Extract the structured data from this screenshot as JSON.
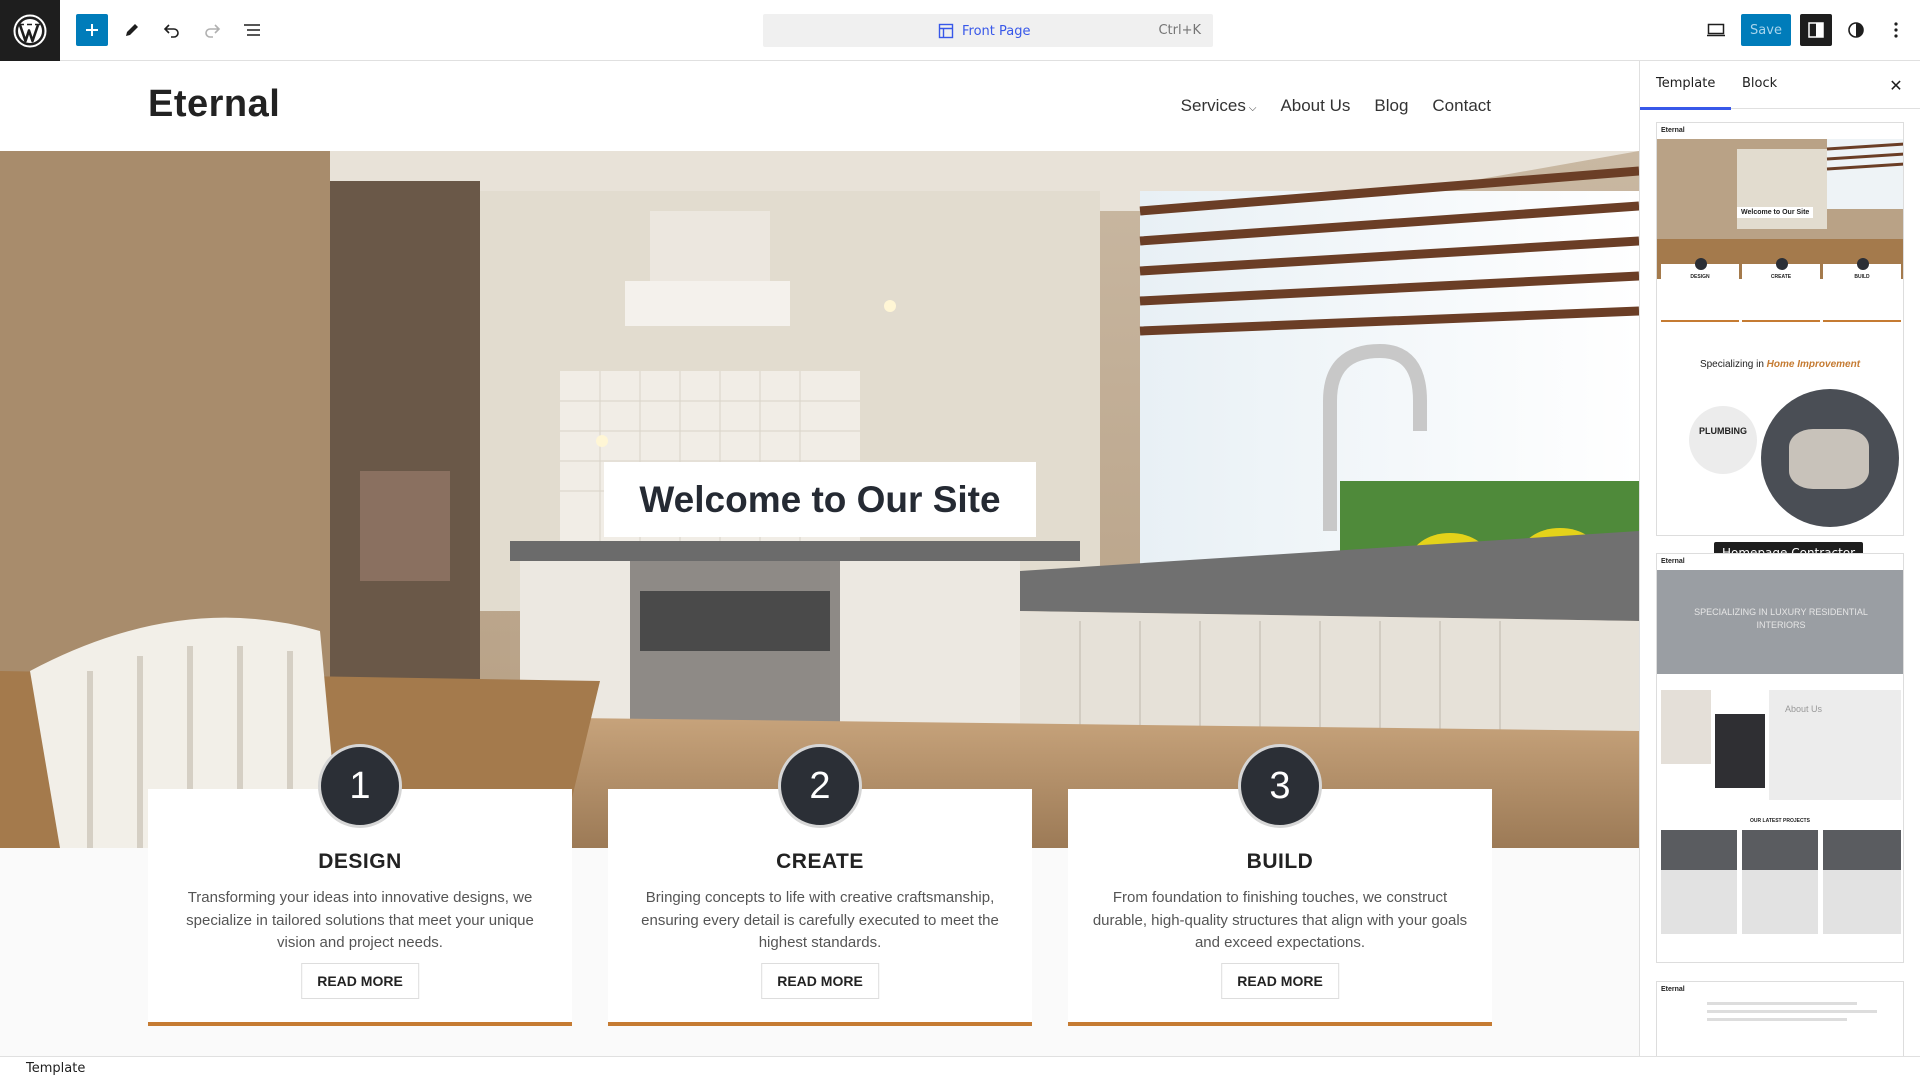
{
  "toolbar": {
    "logo_icon": "wordpress-icon",
    "add_icon": "plus-icon",
    "tools_icon": "pencil-icon",
    "undo_icon": "undo-icon",
    "redo_icon": "redo-icon",
    "list_view_icon": "list-view-icon",
    "command_bar": {
      "page_title": "Front Page",
      "shortcut": "Ctrl+K",
      "icon": "layout-icon"
    },
    "view_icon": "desktop-icon",
    "save_label": "Save",
    "settings_icon": "sidebar-icon",
    "styles_icon": "contrast-icon",
    "options_icon": "kebab-icon",
    "accent_color": "#007cba"
  },
  "site": {
    "title": "Eternal",
    "nav": [
      {
        "label": "Services",
        "has_submenu": true
      },
      {
        "label": "About Us"
      },
      {
        "label": "Blog"
      },
      {
        "label": "Contact"
      }
    ],
    "hero_title": "Welcome to Our Site",
    "cards": [
      {
        "number": "1",
        "title": "DESIGN",
        "text": "Transforming your ideas into innovative designs, we specialize in tailored solutions that meet your unique vision and project needs.",
        "button": "READ MORE"
      },
      {
        "number": "2",
        "title": "CREATE",
        "text": "Bringing concepts to life with creative craftsmanship, ensuring every detail is carefully executed to meet the highest standards.",
        "button": "READ MORE"
      },
      {
        "number": "3",
        "title": "BUILD",
        "text": "From foundation to finishing touches, we construct durable, high-quality structures that align with your goals and exceed expectations.",
        "button": "READ MORE"
      }
    ],
    "card_accent": "#c57b32"
  },
  "sidebar": {
    "tabs": [
      "Template",
      "Block"
    ],
    "active_tab": "Template",
    "close_icon": "close-icon",
    "tooltip": "Homepage Contractor",
    "thumbs": [
      {
        "site_title": "Eternal",
        "hero": "Welcome to Our Site",
        "steps": [
          "DESIGN",
          "CREATE",
          "BUILD"
        ],
        "heading_prefix": "Specializing in",
        "heading_highlight": "Home Improvement",
        "circle_label": "PLUMBING"
      },
      {
        "site_title": "Eternal",
        "banner": "SPECIALIZING IN LUXURY RESIDENTIAL INTERIORS",
        "about": "About Us",
        "projects": "OUR LATEST PROJECTS"
      },
      {
        "site_title": "Eternal"
      }
    ]
  },
  "footer": {
    "label": "Template"
  }
}
